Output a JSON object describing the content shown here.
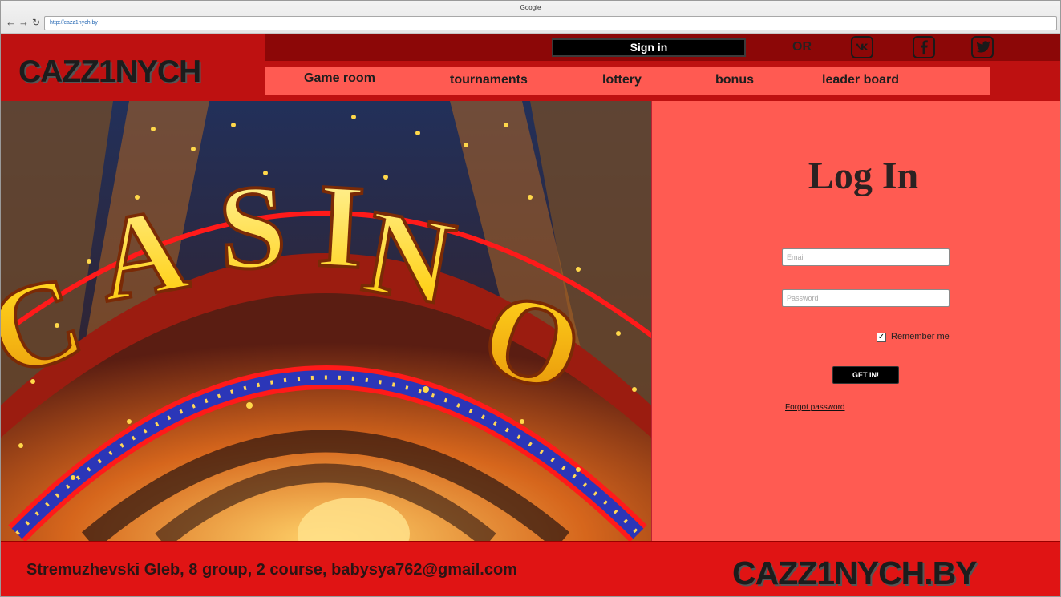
{
  "browser": {
    "window_title": "Google",
    "url": "http://cazz1nych.by",
    "back_icon": "arrow-left",
    "forward_icon": "arrow-right",
    "reload_icon": "reload"
  },
  "header": {
    "logo": "CAZZ1NYCH",
    "sign_in_label": "Sign in",
    "or_label": "OR",
    "social": [
      "vk-icon",
      "facebook-icon",
      "twitter-icon"
    ]
  },
  "menu": {
    "items": [
      {
        "label": "Game room"
      },
      {
        "label": "tournaments"
      },
      {
        "label": "lottery"
      },
      {
        "label": "bonus"
      },
      {
        "label": "leader board"
      }
    ]
  },
  "hero": {
    "sign_text": "CASINO"
  },
  "login": {
    "title": "Log In",
    "email_placeholder": "Email",
    "password_placeholder": "Password",
    "remember_label": "Remember me",
    "remember_checked": true,
    "submit_label": "GET IN!",
    "forgot_label": "Forgot password"
  },
  "footer": {
    "credits": "Stremuzhevski Gleb, 8 group, 2 course, babysya762@gmail.com",
    "logo": "CAZZ1NYCH.BY"
  },
  "colors": {
    "header_red": "#be1111",
    "strip_dark": "#8c0707",
    "menu_salmon": "#ff5a52",
    "login_bg": "#ff5b52",
    "footer_red": "#e01414"
  }
}
